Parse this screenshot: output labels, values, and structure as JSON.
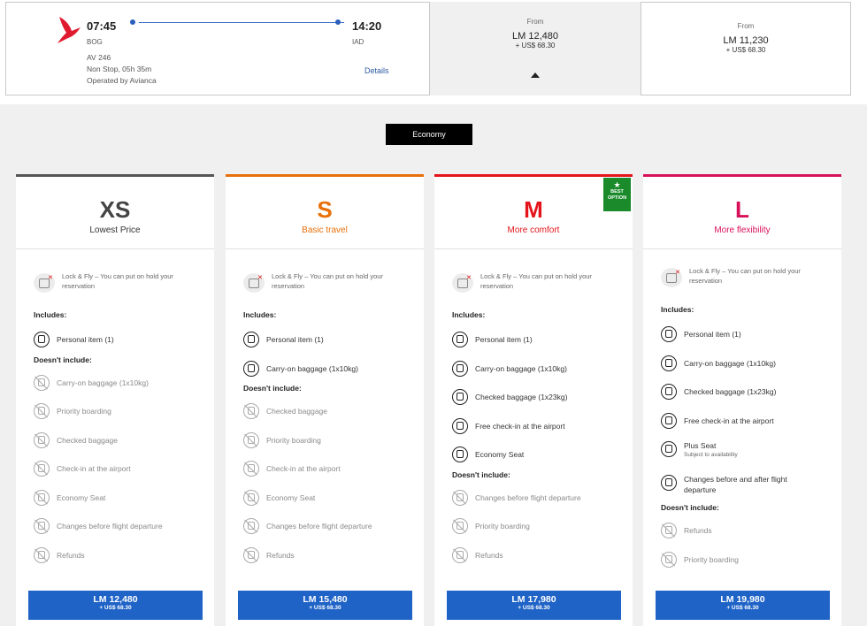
{
  "flight": {
    "depart_time": "07:45",
    "arrive_time": "14:20",
    "origin": "BOG",
    "destination": "IAD",
    "flight_number": "AV 246",
    "duration": "Non Stop, 05h 35m",
    "operator": "Operated by Avianca",
    "details_label": "Details"
  },
  "price_selected": {
    "from": "From",
    "amount": "LM 12,480",
    "usd": "+ US$ 68.30"
  },
  "price_other": {
    "from": "From",
    "amount": "LM 11,230",
    "usd": "+ US$ 68.30"
  },
  "cabin": "Economy",
  "colors": {
    "xs": "#555555",
    "s": "#e8700a",
    "m": "#e4141a",
    "l": "#d8105a",
    "button": "#1f63c6",
    "best": "#1a8a2a"
  },
  "cards": [
    {
      "size": "XS",
      "subtitle": "Lowest Price",
      "lock": "Lock & Fly – You can put on hold your reservation",
      "includes_label": "Includes:",
      "includes": [
        {
          "text": "Personal item (1)",
          "icon": "backpack-icon"
        }
      ],
      "excludes_label": "Doesn't include:",
      "excludes": [
        {
          "text": "Carry-on baggage (1x10kg)",
          "icon": "carry-on-icon"
        },
        {
          "text": "Priority boarding",
          "icon": "priority-icon"
        },
        {
          "text": "Checked baggage",
          "icon": "suitcase-icon"
        },
        {
          "text": "Check-in at the airport",
          "icon": "checkin-icon"
        },
        {
          "text": "Economy Seat",
          "icon": "seat-icon"
        },
        {
          "text": "Changes before flight departure",
          "icon": "plane-change-icon"
        },
        {
          "text": "Refunds",
          "icon": "refund-icon"
        }
      ],
      "price": "LM 12,480",
      "usd": "+ US$ 68.30"
    },
    {
      "size": "S",
      "subtitle": "Basic travel",
      "lock": "Lock & Fly – You can put on hold your reservation",
      "includes_label": "Includes:",
      "includes": [
        {
          "text": "Personal item (1)",
          "icon": "backpack-icon"
        },
        {
          "text": "Carry-on baggage (1x10kg)",
          "icon": "carry-on-icon"
        }
      ],
      "excludes_label": "Doesn't include:",
      "excludes": [
        {
          "text": "Checked baggage",
          "icon": "suitcase-icon"
        },
        {
          "text": "Priority boarding",
          "icon": "priority-icon"
        },
        {
          "text": "Check-in at the airport",
          "icon": "checkin-icon"
        },
        {
          "text": "Economy Seat",
          "icon": "seat-icon"
        },
        {
          "text": "Changes before flight departure",
          "icon": "plane-change-icon"
        },
        {
          "text": "Refunds",
          "icon": "refund-icon"
        }
      ],
      "price": "LM 15,480",
      "usd": "+ US$ 68.30"
    },
    {
      "size": "M",
      "subtitle": "More comfort",
      "best_line1": "BEST",
      "best_line2": "OPTION",
      "lock": "Lock & Fly – You can put on hold your reservation",
      "includes_label": "Includes:",
      "includes": [
        {
          "text": "Personal item (1)",
          "icon": "backpack-icon"
        },
        {
          "text": "Carry-on baggage (1x10kg)",
          "icon": "carry-on-icon"
        },
        {
          "text": "Checked baggage (1x23kg)",
          "icon": "suitcase-icon"
        },
        {
          "text": "Free check-in at the airport",
          "icon": "checkin-icon"
        },
        {
          "text": "Economy Seat",
          "icon": "seat-icon"
        }
      ],
      "excludes_label": "Doesn't include:",
      "excludes": [
        {
          "text": "Changes before flight departure",
          "icon": "plane-change-icon"
        },
        {
          "text": "Priority boarding",
          "icon": "priority-icon"
        },
        {
          "text": "Refunds",
          "icon": "refund-icon"
        }
      ],
      "price": "LM 17,980",
      "usd": "+ US$ 68.30"
    },
    {
      "size": "L",
      "subtitle": "More flexibility",
      "lock": "Lock & Fly – You can put on hold your reservation",
      "includes_label": "Includes:",
      "includes": [
        {
          "text": "Personal item (1)",
          "icon": "backpack-icon"
        },
        {
          "text": "Carry-on baggage (1x10kg)",
          "icon": "carry-on-icon"
        },
        {
          "text": "Checked baggage (1x23kg)",
          "icon": "suitcase-icon"
        },
        {
          "text": "Free check-in at the airport",
          "icon": "checkin-icon"
        },
        {
          "text": "Plus Seat",
          "sub": "Subject to availability",
          "icon": "seat-icon"
        },
        {
          "text": "Changes before and after flight departure",
          "icon": "plane-change-icon"
        }
      ],
      "excludes_label": "Doesn't include:",
      "excludes": [
        {
          "text": "Refunds",
          "icon": "refund-icon"
        },
        {
          "text": "Priority boarding",
          "icon": "priority-icon"
        }
      ],
      "price": "LM 19,980",
      "usd": "+ US$ 68.30"
    }
  ]
}
